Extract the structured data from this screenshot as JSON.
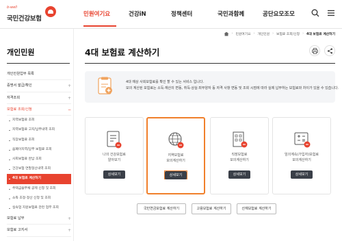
{
  "header": {
    "logo_small": "b-well",
    "logo_text": "국민건강보험",
    "nav": [
      "민원여기요",
      "건강iN",
      "정책센터",
      "국민과함께",
      "공단요모조모"
    ],
    "search_icon": "search-icon",
    "menu_icon": "hamburger-menu-icon"
  },
  "sidebar": {
    "title": "개인민원",
    "items": [
      {
        "label": "개인민원업무 목록",
        "expandable": false
      },
      {
        "label": "증명서 발급/확인",
        "expandable": true
      },
      {
        "label": "자격조회",
        "expandable": true
      },
      {
        "label": "보험료 조회/신청",
        "expandable": true,
        "open": true
      }
    ],
    "subitems": [
      "지역보험료 조회",
      "지역보험료 고지/납부내역 조회",
      "직장보험료 조회",
      "음폐이지역/납부 보험료 조회",
      "사회보험료 완납 조회",
      "건강보험 연말정산내역 조회",
      "4대 보험료 계산하기",
      "주택금융부채 공제 신청 및 조회",
      "소득 조정·정산 신청 및 조회",
      "실속업 지원보험료 관련 업무 조회"
    ],
    "active_subitem": "4대 보험료 계산하기",
    "bottom_items": [
      "보험료 납부",
      "보험료 고지서"
    ]
  },
  "breadcrumb": [
    "민원여기요",
    "개인민원",
    "보험료 조회/신청",
    "4대 보험료 계산하기"
  ],
  "main": {
    "title": "4대 보험료 계산하기",
    "print_icon": "print-icon",
    "share_icon": "share-icon",
    "notice_lines": [
      "4대 예상 사회보험료를 확인 할 수 있는 서비스 입니다.",
      "모의 계산된 보험료는 소득·재산의 변동, 취득·상실·피부양자 등 자격 사항 변동 및 조회 시점에 따라 실제 납부하는 보험료와 차이가 있을 수 있습니다."
    ],
    "cards": [
      {
        "line1": "나의 건강보험료",
        "line2": "알아보기",
        "button": "상세보기",
        "icon": "calculator-doc-icon"
      },
      {
        "line1": "지역보험료",
        "line2": "모의계산하기",
        "button": "상세보기",
        "icon": "globe-calculator-icon",
        "selected": true
      },
      {
        "line1": "직장보험료",
        "line2": "모의계산하기",
        "button": "상세보기",
        "icon": "building-calculator-icon"
      },
      {
        "line1": "임의계속(가입자)보험료",
        "line2": "모의계산하기",
        "button": "상세보기",
        "icon": "calculator-icon"
      }
    ],
    "bottom_buttons": [
      "국민연금보험료 계산하기",
      "고용보험료 계산하기",
      "산재보험료 계산하기"
    ]
  },
  "colors": {
    "accent": "#e8432f",
    "highlight": "#f07f2a",
    "button": "#3a3f48"
  }
}
